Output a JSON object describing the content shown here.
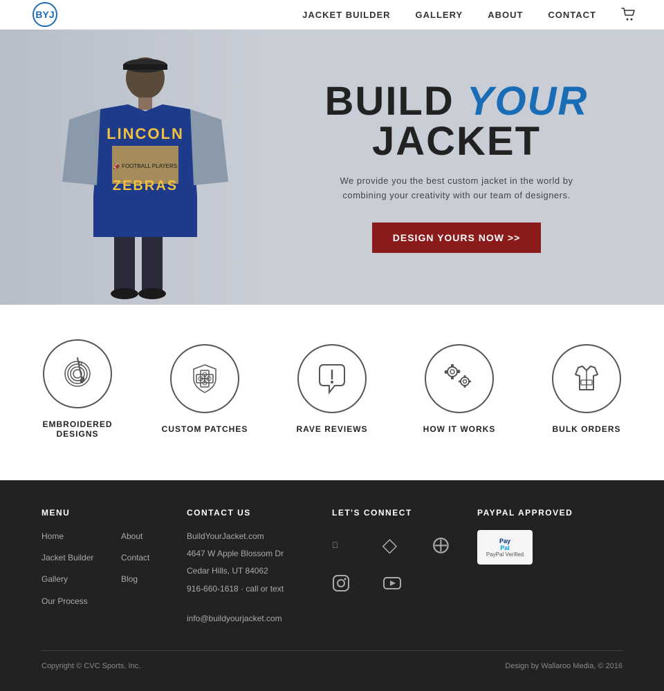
{
  "header": {
    "logo_text": "BYJ",
    "nav_items": [
      {
        "label": "JACKET BUILDER",
        "href": "#"
      },
      {
        "label": "GALLERY",
        "href": "#"
      },
      {
        "label": "ABOUT",
        "href": "#"
      },
      {
        "label": "CONTACT",
        "href": "#"
      }
    ]
  },
  "hero": {
    "title_part1": "BUILD ",
    "title_highlight": "YOUR",
    "title_part2": " JACKET",
    "subtitle_line1": "We provide you the best custom jacket in the world by",
    "subtitle_line2": "combining your creativity with our team of designers.",
    "cta_label": "DESIGN YOURS NOW >>"
  },
  "features": [
    {
      "id": "embroidered",
      "label": "EMBROIDERED DESIGNS",
      "icon": "needle"
    },
    {
      "id": "patches",
      "label": "CUSTOM PATCHES",
      "icon": "patches"
    },
    {
      "id": "reviews",
      "label": "RAVE REVIEWS",
      "icon": "reviews"
    },
    {
      "id": "how",
      "label": "HOW IT WORKS",
      "icon": "gears"
    },
    {
      "id": "bulk",
      "label": "BULK ORDERS",
      "icon": "jacket"
    }
  ],
  "footer": {
    "menu_title": "MENU",
    "menu_items_col1": [
      "Home",
      "Jacket Builder",
      "Gallery",
      "Our Process"
    ],
    "menu_items_col2": [
      "About",
      "Contact",
      "Blog"
    ],
    "contact_title": "CONTACT US",
    "contact_lines": [
      "BuildYourJacket.com",
      "4647 W Apple Blossom Dr",
      "Cedar Hills, UT 84062",
      "916-660-1618 · call or text",
      "",
      "info@buildyourjacket.com"
    ],
    "connect_title": "LET'S CONNECT",
    "paypal_title": "PAYPAL APPROVED",
    "paypal_label": "PayPal Verified",
    "copyright": "Copyright © CVC Sports, Inc.",
    "design_credit": "Design by Wallaroo Media, © 2016"
  }
}
